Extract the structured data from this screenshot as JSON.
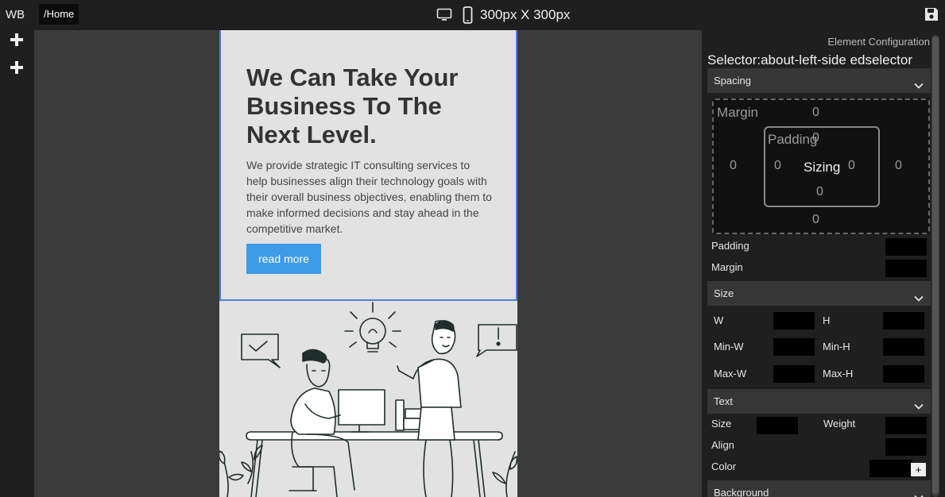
{
  "app": {
    "brand": "WB",
    "route": "/Home",
    "dimensions": "300px X 300px"
  },
  "icons": {
    "desktop": "desktop-icon",
    "mobile": "mobile-icon",
    "save": "save-icon",
    "add": "plus-icon",
    "chevron": "chevron-down-icon"
  },
  "page": {
    "headline": "We Can Take Your Business To The Next Level.",
    "paragraph": "We provide strategic IT consulting services to help businesses align their technology goals with their overall business objectives, enabling them to make informed decisions and stay ahead in the competitive market.",
    "button": "read more"
  },
  "panel": {
    "title": "Element Configuration",
    "selector_label": "Selector:",
    "selector_value": "about-left-side edselector",
    "spacing": {
      "header": "Spacing",
      "margin_label": "Margin",
      "padding_label": "Padding",
      "sizing_label": "Sizing",
      "margin": {
        "top": "0",
        "right": "0",
        "bottom": "0",
        "left": "0"
      },
      "padding": {
        "top": "0",
        "right": "0",
        "bottom": "0",
        "left": "0"
      },
      "padding_row": "Padding",
      "margin_row": "Margin"
    },
    "size": {
      "header": "Size",
      "w": "W",
      "h": "H",
      "min_w": "Min-W",
      "min_h": "Min-H",
      "max_w": "Max-W",
      "max_h": "Max-H"
    },
    "text": {
      "header": "Text",
      "size": "Size",
      "weight": "Weight",
      "align": "Align",
      "color": "Color",
      "add": "+"
    },
    "background": {
      "header": "Background"
    }
  },
  "colors": {
    "accent": "#3d9be9",
    "selection": "#4a7fe6",
    "panel_bg": "#1f1f1f",
    "canvas_bg": "#3b3b3b",
    "page_bg": "#e2e2e2"
  }
}
